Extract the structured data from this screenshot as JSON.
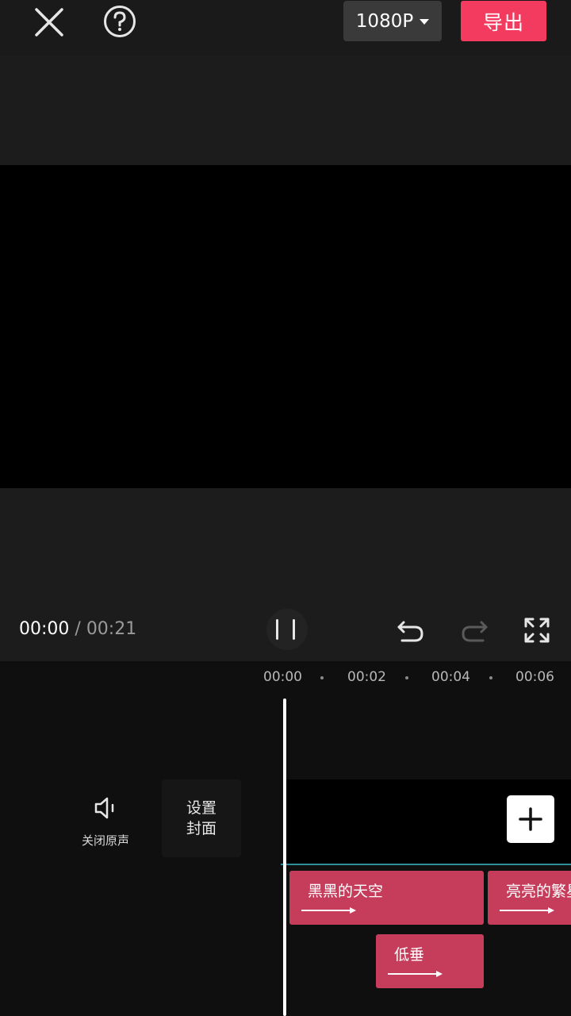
{
  "header": {
    "resolution_label": "1080P",
    "export_label": "导出"
  },
  "playback": {
    "current_time": "00:00",
    "separator": " / ",
    "total_time": "00:21"
  },
  "ruler": {
    "labels": [
      "00:00",
      "00:02",
      "00:04",
      "00:06"
    ]
  },
  "track_tools": {
    "mute_label": "关闭原声",
    "cover_label_line1": "设置",
    "cover_label_line2": "封面"
  },
  "text_clips": [
    {
      "label": "黑黑的天空"
    },
    {
      "label": "亮亮的繁星"
    },
    {
      "label": "低垂"
    }
  ],
  "colors": {
    "accent": "#f23b5e",
    "clip": "#c63d5c",
    "track_line": "#2e8f9a"
  },
  "icons": {
    "close": "close-icon",
    "help": "help-icon",
    "dropdown": "chevron-down-icon",
    "pause": "pause-icon",
    "undo": "undo-icon",
    "redo": "redo-icon",
    "fullscreen": "fullscreen-icon",
    "mute": "speaker-icon",
    "add": "plus-icon",
    "arrow": "arrow-right-icon"
  }
}
